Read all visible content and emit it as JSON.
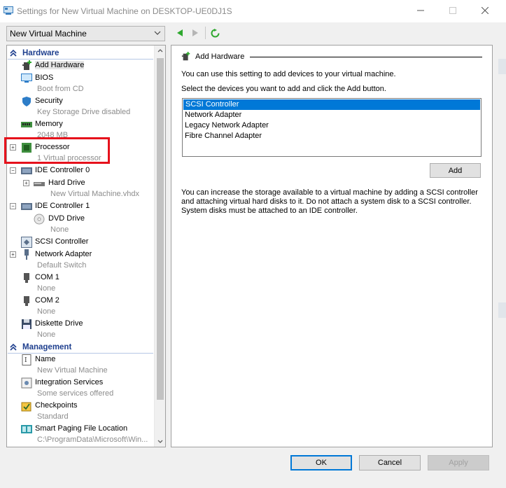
{
  "window": {
    "title": "Settings for New Virtual Machine on DESKTOP-UE0DJ1S"
  },
  "vm_selector": {
    "value": "New Virtual Machine"
  },
  "tree": {
    "hardware_header": "Hardware",
    "management_header": "Management",
    "hardware": [
      {
        "label": "Add Hardware",
        "sub": ""
      },
      {
        "label": "BIOS",
        "sub": "Boot from CD"
      },
      {
        "label": "Security",
        "sub": "Key Storage Drive disabled"
      },
      {
        "label": "Memory",
        "sub": "2048 MB"
      },
      {
        "label": "Processor",
        "sub": "1 Virtual processor"
      },
      {
        "label": "IDE Controller 0",
        "sub": ""
      },
      {
        "label": "Hard Drive",
        "sub": "New Virtual Machine.vhdx"
      },
      {
        "label": "IDE Controller 1",
        "sub": ""
      },
      {
        "label": "DVD Drive",
        "sub": "None"
      },
      {
        "label": "SCSI Controller",
        "sub": ""
      },
      {
        "label": "Network Adapter",
        "sub": "Default Switch"
      },
      {
        "label": "COM 1",
        "sub": "None"
      },
      {
        "label": "COM 2",
        "sub": "None"
      },
      {
        "label": "Diskette Drive",
        "sub": "None"
      }
    ],
    "management": [
      {
        "label": "Name",
        "sub": "New Virtual Machine"
      },
      {
        "label": "Integration Services",
        "sub": "Some services offered"
      },
      {
        "label": "Checkpoints",
        "sub": "Standard"
      },
      {
        "label": "Smart Paging File Location",
        "sub": "C:\\ProgramData\\Microsoft\\Win..."
      }
    ]
  },
  "pane": {
    "title": "Add Hardware",
    "intro": "You can use this setting to add devices to your virtual machine.",
    "instruction": "Select the devices you want to add and click the Add button.",
    "devices": [
      "SCSI Controller",
      "Network Adapter",
      "Legacy Network Adapter",
      "Fibre Channel Adapter"
    ],
    "selected_device": "SCSI Controller",
    "add_label": "Add",
    "note_line1": "You can increase the storage available to a virtual machine by adding a SCSI controller",
    "note_line2": "and attaching virtual hard disks to it. Do not attach a system disk to a SCSI controller.",
    "note_line3": "System disks must be attached to an IDE controller."
  },
  "buttons": {
    "ok": "OK",
    "cancel": "Cancel",
    "apply": "Apply"
  },
  "colors": {
    "accent": "#0078d7",
    "highlight": "#e6121c",
    "header_text": "#1e3f8e"
  }
}
